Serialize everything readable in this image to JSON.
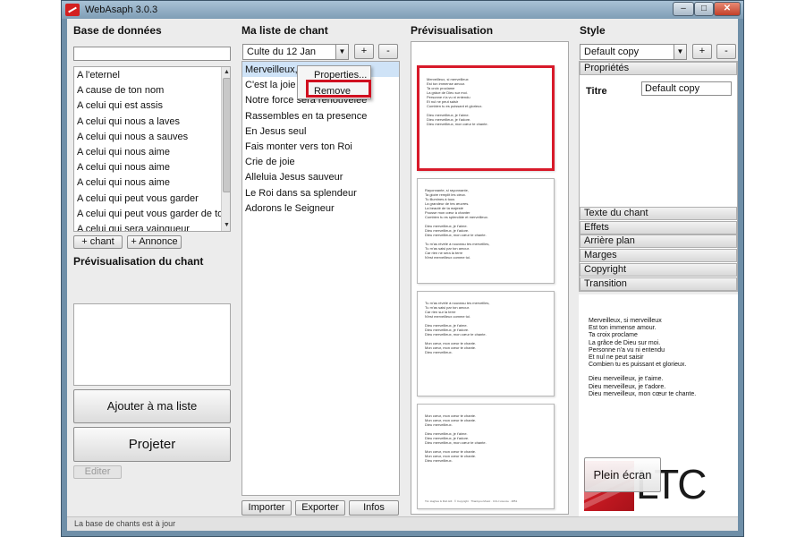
{
  "window": {
    "title": "WebAsaph 3.0.3",
    "controls": {
      "minimize": "–",
      "maximize": "□",
      "close": "✕"
    }
  },
  "database": {
    "header": "Base de données",
    "search_value": "",
    "songs": [
      "A l'eternel",
      "A cause de ton nom",
      "A celui qui est assis",
      "A celui qui nous a laves",
      "A celui qui nous a sauves",
      "A celui qui nous aime",
      "A celui qui nous aime",
      "A celui qui nous aime",
      "A celui qui peut vous garder",
      "A celui qui peut vous garder de tombe",
      "A celui qui sera vainqueur"
    ],
    "add_song_label": "+ chant",
    "add_announce_label": "+ Annonce",
    "song_preview_header": "Prévisualisation du chant",
    "add_to_list_label": "Ajouter à ma liste",
    "project_label": "Projeter",
    "edit_label": "Editer"
  },
  "playlist": {
    "header": "Ma liste de chant",
    "selected_list": "Culte du 12 Jan",
    "add_label": "+",
    "remove_label": "-",
    "items": [
      "Merveilleux, si merveilleux",
      "C'est la joie",
      "Notre force sera renouvelee",
      "Rassembles en ta presence",
      "En Jesus seul",
      "Fais monter vers ton Roi",
      "Crie de joie",
      "Alleluia Jesus sauveur",
      "Le Roi dans sa splendeur",
      "Adorons le Seigneur"
    ],
    "context_menu": [
      "Properties...",
      "Remove"
    ],
    "import_label": "Importer",
    "export_label": "Exporter",
    "info_label": "Infos"
  },
  "preview": {
    "header": "Prévisualisation",
    "slides": [
      {
        "lines": [
          "Merveilleux, si merveilleux",
          "Est ton immense amour.",
          "Ta croix proclame",
          "La grâce de Dieu sur moi.",
          "Personne n'a vu ni entendu",
          "Et nul ne peut saisir",
          "Combien tu es puissant et glorieux.",
          "",
          "Dieu merveilleux, je t'aime.",
          "Dieu merveilleux, je t'adore.",
          "Dieu merveilleux, mon cœur te chante."
        ],
        "footer": ""
      },
      {
        "lines": [
          "Rayonnante, si rayonnante,",
          "Ta gloire remplit les cieux.",
          "Tu illumines à tous",
          "La grandeur de tes œuvres.",
          "La beauté de ta majesté",
          "Pousse mon cœur à chanter",
          "Combien tu es splendide et merveilleux.",
          "",
          "Dieu merveilleux, je t'aime.",
          "Dieu merveilleux, je t'adore.",
          "Dieu merveilleux, mon cœur te chante.",
          "",
          "Tu m'as révélé à nouveau tes merveilles,",
          "Tu m'as saisi par ton amour.",
          "Car rien ne sera la terre",
          "N'est merveilleux comme toi."
        ],
        "footer": ""
      },
      {
        "lines": [
          "Tu m'as révélé à nouveau tes merveilles,",
          "Tu m'as saisi par ton amour.",
          "Car rien sur la terre",
          "N'est merveilleux comme toi.",
          "",
          "Dieu merveilleux, je t'aime.",
          "Dieu merveilleux, je t'adore.",
          "Dieu merveilleux, mon cœur te chante.",
          "",
          "Mon cœur, mon cœur te chante.",
          "Mon cœur, mon cœur te chante.",
          "Dieu merveilleux."
        ],
        "footer": ""
      },
      {
        "lines": [
          "Mon cœur, mon cœur te chante.",
          "Mon cœur, mon cœur te chante.",
          "Dieu merveilleux.",
          "",
          "Dieu merveilleux, je t'aime.",
          "Dieu merveilleux, je t'adore.",
          "Dieu merveilleux, mon cœur te chante.",
          "",
          "Mon cœur, mon cœur te chante.",
          "Mon cœur, mon cœur te chante.",
          "Dieu merveilleux."
        ],
        "footer": "Tim Hughes & Rob Hill · © Copyright · Thankyou Music · CCLI Licence · 4851"
      }
    ]
  },
  "style": {
    "header": "Style",
    "selected_style": "Default copy",
    "add_label": "+",
    "remove_label": "-",
    "properties_header": "Propriétés",
    "title_label": "Titre",
    "title_value": "Default copy",
    "sections": [
      "Texte du chant",
      "Effets",
      "Arrière plan",
      "Marges",
      "Copyright",
      "Transition"
    ],
    "preview_lines": [
      "Merveilleux, si merveilleux",
      "Est ton immense amour.",
      "Ta croix proclame",
      "La grâce de Dieu sur moi.",
      "Personne n'a vu ni entendu",
      "Et nul ne peut saisir",
      "Combien tu es puissant et glorieux.",
      "",
      "Dieu merveilleux, je t'aime.",
      "Dieu merveilleux, je t'adore.",
      "Dieu merveilleux, mon cœur te chante."
    ],
    "fullscreen_label": "Plein écran",
    "logo_text": "LTC"
  },
  "status": {
    "message": "La base de chants est à jour"
  },
  "colors": {
    "selection": "#cfe3f7",
    "accent_red": "#d81a2a"
  }
}
